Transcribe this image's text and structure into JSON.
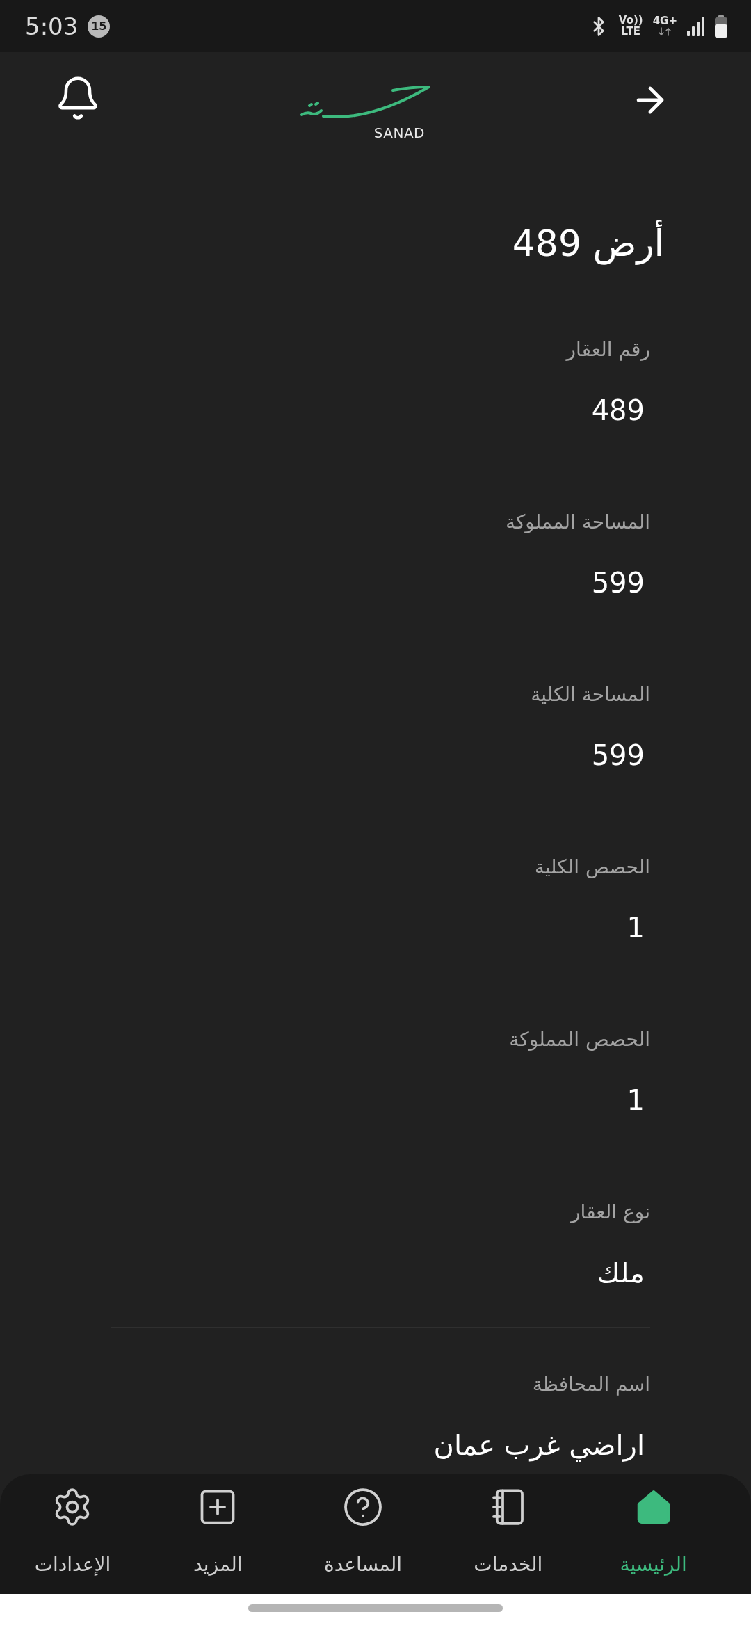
{
  "status_bar": {
    "time": "5:03",
    "notification_count": "15",
    "volte": "Vo)) LTE",
    "network": "4G+"
  },
  "header": {
    "logo_text": "SANAD"
  },
  "title": "أرض 489",
  "fields": [
    {
      "label": "رقم العقار",
      "value": "489",
      "divider": false
    },
    {
      "label": "المساحة المملوكة",
      "value": "599",
      "divider": false
    },
    {
      "label": "المساحة الكلية",
      "value": "599",
      "divider": false
    },
    {
      "label": "الحصص الكلية",
      "value": "1",
      "divider": false
    },
    {
      "label": "الحصص المملوكة",
      "value": "1",
      "divider": false
    },
    {
      "label": "نوع العقار",
      "value": "ملك",
      "divider": true
    },
    {
      "label": "اسم المحافظة",
      "value": "اراضي غرب عمان",
      "divider": false
    }
  ],
  "nav": [
    {
      "label": "الرئيسية",
      "selected": true
    },
    {
      "label": "الخدمات",
      "selected": false
    },
    {
      "label": "المساعدة",
      "selected": false
    },
    {
      "label": "المزيد",
      "selected": false
    },
    {
      "label": "الإعدادات",
      "selected": false
    }
  ]
}
